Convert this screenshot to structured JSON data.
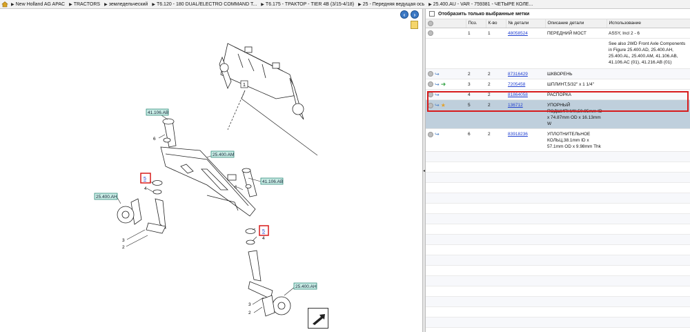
{
  "breadcrumb": {
    "items": [
      "New Holland AG APAC",
      "TRACTORS",
      "земледельческий",
      "T6.120 - 180 DUAL/ELECTRO COMMAND T...",
      "T6.175 - ТРАКТОР - TIER 4B (3/15-4/18)",
      "25 - Передняя ведущая ось",
      "25.400.AU - VAR - 759381 - ЧЕТЫРЕ КОЛЕ..."
    ]
  },
  "diagram": {
    "callouts": {
      "ref_top": "41.106.AB",
      "ref_axle": "25.400.AM",
      "ref_left_hub": "25.400.AH",
      "ref_right_knuckle": "41.106.AB",
      "ref_bottom_hub": "25.400.AH"
    },
    "numbers": {
      "n1": "1",
      "n6a": "6",
      "n5a": "5",
      "n4a": "4",
      "n6b": "6",
      "n3a": "3",
      "n2a": "2",
      "n5b": "5",
      "n4b": "4",
      "n3b": "3",
      "n2b": "2"
    }
  },
  "right_panel": {
    "filter_label": "Отобразить только выбранные метки",
    "headers": {
      "pos": "Поз.",
      "qty": "К-во",
      "part_no": "№ детали",
      "description": "Описание детали",
      "usage": "Использование"
    },
    "rows": [
      {
        "pos": "1",
        "qty": "1",
        "part_no": "48058524",
        "description": "ПЕРЕДНИЙ МОСТ",
        "usage": "ASSY, Incl 2 - 6"
      },
      {
        "pos": "",
        "qty": "",
        "part_no": "",
        "description": "",
        "usage": "See also 2WD Front Axle Components in Figure 25.400.AD, 25.400.AH, 25.400.AL, 25.400.AM, 41.106.AB, 41.106.AC (01), 41.216.AB (01)"
      },
      {
        "pos": "2",
        "qty": "2",
        "part_no": "87316429",
        "description": "ШКВОРЕНЬ",
        "usage": ""
      },
      {
        "pos": "3",
        "qty": "2",
        "part_no": "7205458",
        "description": "ШПЛИНТ,5/32\" x 1 1/4\"",
        "usage": ""
      },
      {
        "pos": "4",
        "qty": "2",
        "part_no": "81864058",
        "description": "РАСПОРКА",
        "usage": ""
      },
      {
        "pos": "5",
        "qty": "2",
        "part_no": "136712",
        "description": "УПОРНЫЙ ПОДШИПНИК,50.95mm ID x 74.87mm OD x 16.13mm W",
        "usage": ""
      },
      {
        "pos": "6",
        "qty": "2",
        "part_no": "83918236",
        "description": "УПЛОТНИТЕЛЬНОЕ КОЛЬЦ,38.1mm ID x 57.1mm OD x 9.98mm Thk",
        "usage": ""
      }
    ]
  },
  "colors": {
    "callout_fill": "#c9ece5",
    "callout_border": "#2f8a79",
    "selection_border": "#d71a1a",
    "selected_row": "#bfcfdc",
    "link": "#1f3fd0"
  }
}
